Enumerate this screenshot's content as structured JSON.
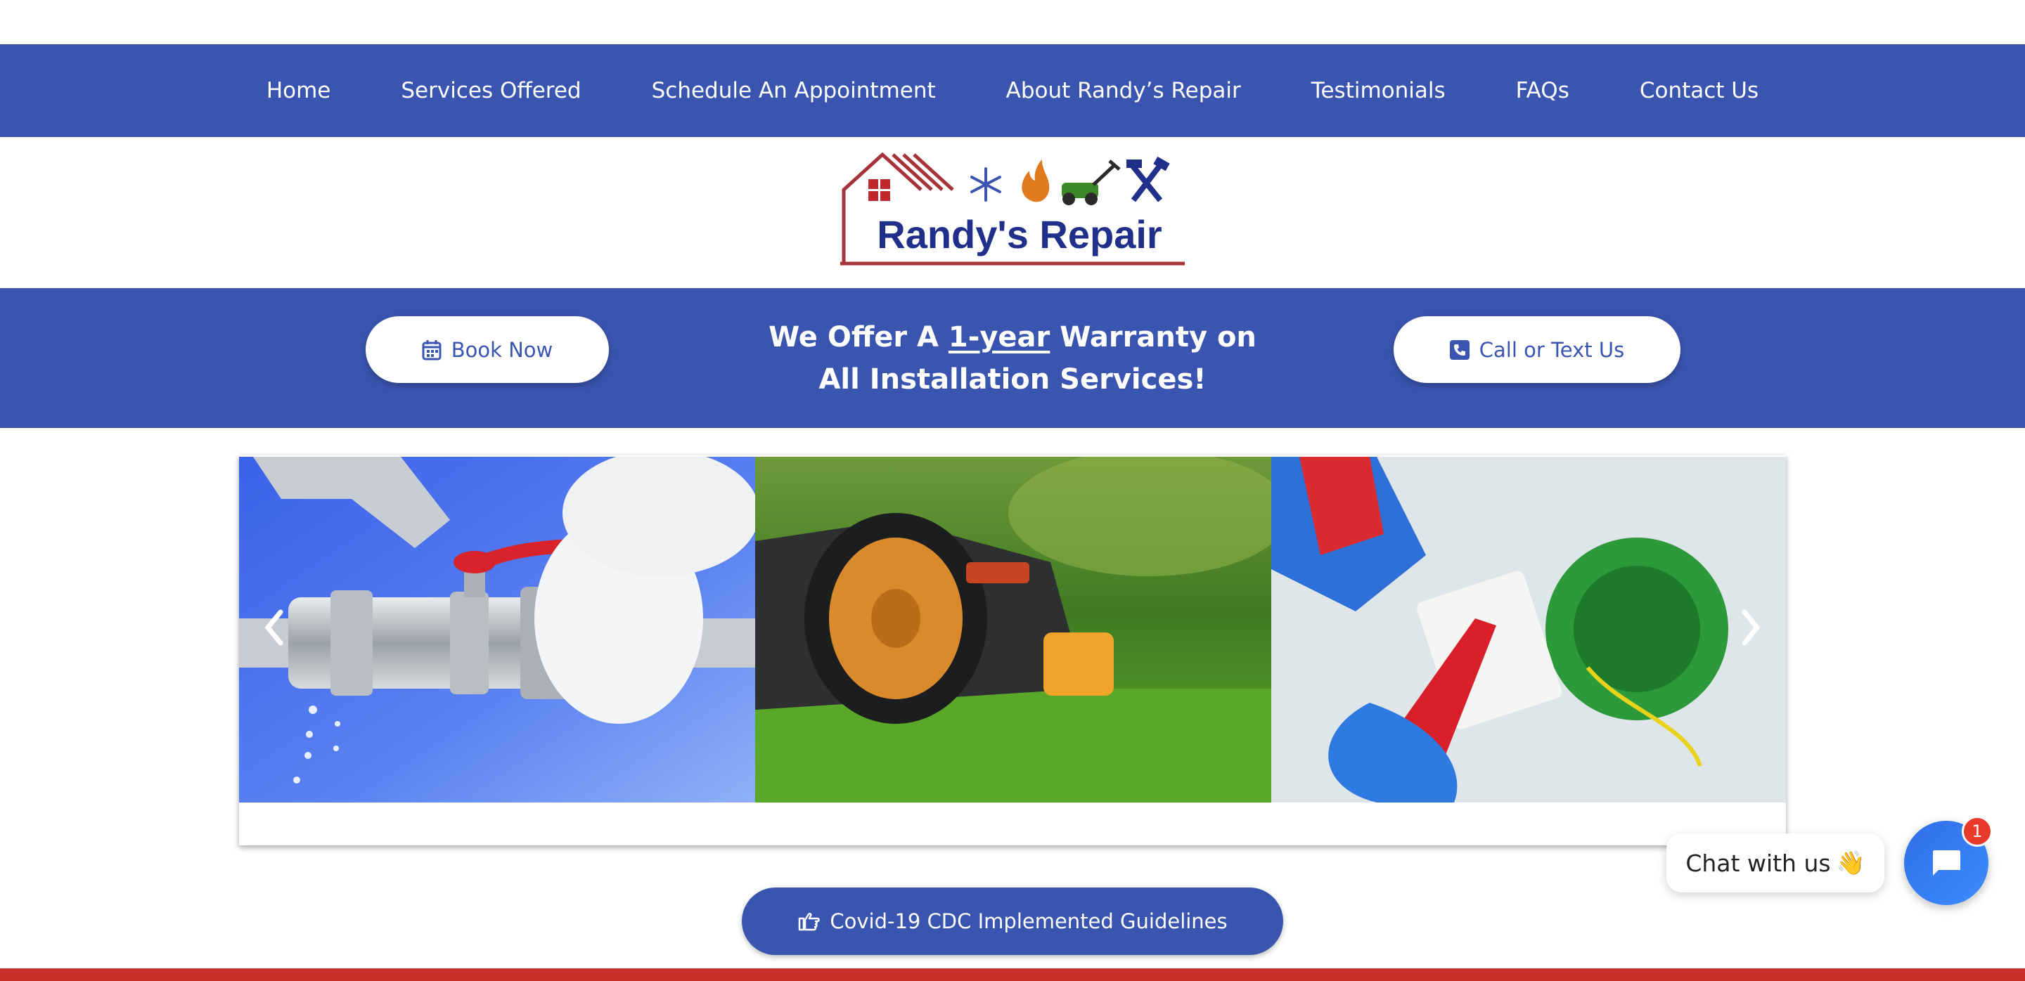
{
  "nav": {
    "items": [
      {
        "label": "Home"
      },
      {
        "label": "Services Offered"
      },
      {
        "label": "Schedule An Appointment"
      },
      {
        "label": "About Randy’s Repair"
      },
      {
        "label": "Testimonials"
      },
      {
        "label": "FAQs"
      },
      {
        "label": "Contact Us"
      }
    ]
  },
  "logo": {
    "text": "Randy's Repair",
    "icons": [
      "house-icon",
      "snowflake-icon",
      "flame-icon",
      "lawn-mower-icon",
      "tools-icon"
    ]
  },
  "banner": {
    "book_label": "Book Now",
    "book_icon": "calendar-icon",
    "warranty_pre": "We Offer A ",
    "warranty_em": "1-year",
    "warranty_post": " Warranty on",
    "warranty_line2": "All Installation Services!",
    "call_label": "Call or Text Us",
    "call_icon": "phone-icon"
  },
  "carousel": {
    "slides": [
      {
        "subject": "plumbing valve repair"
      },
      {
        "subject": "robotic lawn mower"
      },
      {
        "subject": "electrical outlet repair"
      }
    ],
    "prev_icon": "chevron-left-icon",
    "next_icon": "chevron-right-icon"
  },
  "covid": {
    "label": "Covid-19 CDC Implemented Guidelines",
    "icon": "hand-pointing-icon"
  },
  "chat": {
    "bubble_text": "Chat with us",
    "bubble_emoji": "👋",
    "badge_count": "1"
  },
  "colors": {
    "brand_blue": "#3a55b0",
    "accent_red": "#c9302c",
    "chat_blue": "#2f6fe8"
  }
}
